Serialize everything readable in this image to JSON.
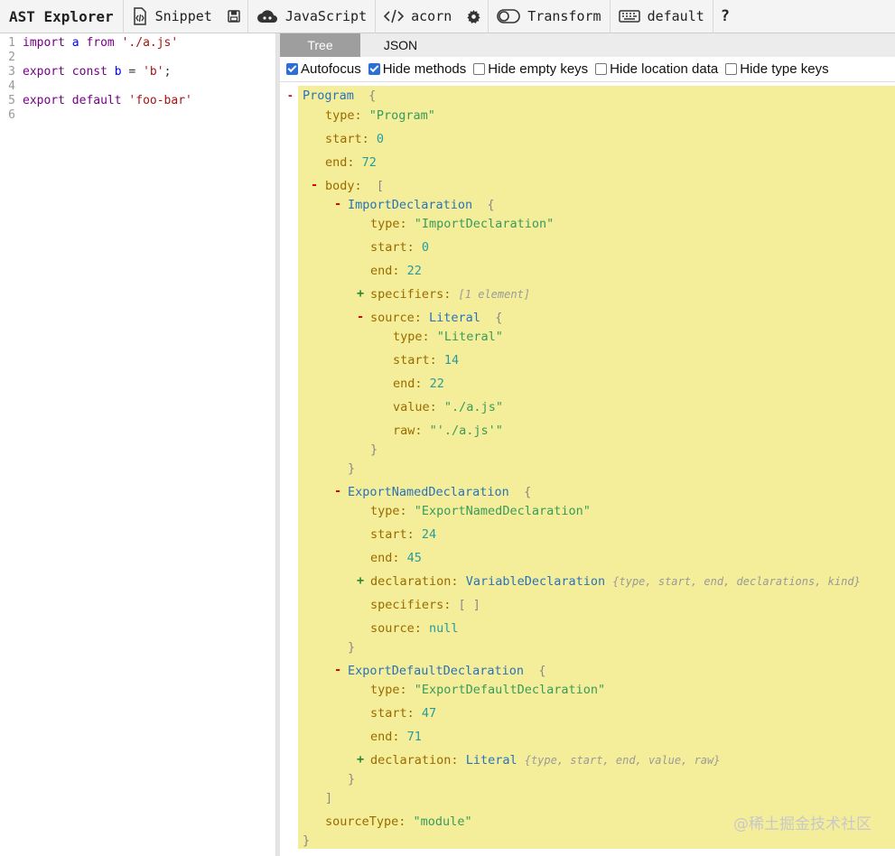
{
  "toolbar": {
    "title": "AST Explorer",
    "snippet": "Snippet",
    "language": "JavaScript",
    "parser": "acorn",
    "transform": "Transform",
    "keymap": "default",
    "help": "?"
  },
  "editor": {
    "lines": [
      {
        "n": "1",
        "text": "import a from './a.js'"
      },
      {
        "n": "2",
        "text": ""
      },
      {
        "n": "3",
        "text": "export const b = 'b';"
      },
      {
        "n": "4",
        "text": ""
      },
      {
        "n": "5",
        "text": "export default 'foo-bar'"
      },
      {
        "n": "6",
        "text": ""
      }
    ]
  },
  "output": {
    "tabs": [
      "Tree",
      "JSON"
    ],
    "active_tab": "Tree",
    "options": [
      {
        "label": "Autofocus",
        "checked": true
      },
      {
        "label": "Hide methods",
        "checked": true
      },
      {
        "label": "Hide empty keys",
        "checked": false
      },
      {
        "label": "Hide location data",
        "checked": false
      },
      {
        "label": "Hide type keys",
        "checked": false
      }
    ]
  },
  "tree": {
    "program": "Program",
    "brace_open": "{",
    "brace_close": "}",
    "bracket_open": "[",
    "bracket_close": "]",
    "empty_array": "[ ]",
    "type_key": "type:",
    "start_key": "start:",
    "end_key": "end:",
    "body_key": "body:",
    "specifiers_key": "specifiers:",
    "source_key": "source:",
    "value_key": "value:",
    "raw_key": "raw:",
    "declaration_key": "declaration:",
    "sourceType_key": "sourceType:",
    "program_type": "\"Program\"",
    "program_start": "0",
    "program_end": "72",
    "import_decl": "ImportDeclaration",
    "import_type": "\"ImportDeclaration\"",
    "import_start": "0",
    "import_end": "22",
    "import_specifiers_summary": "[1 element]",
    "literal": "Literal",
    "lit_type": "\"Literal\"",
    "lit_start": "14",
    "lit_end": "22",
    "lit_value": "\"./a.js\"",
    "lit_raw": "\"'./a.js'\"",
    "named_decl": "ExportNamedDeclaration",
    "named_type": "\"ExportNamedDeclaration\"",
    "named_start": "24",
    "named_end": "45",
    "var_decl": "VariableDeclaration",
    "var_decl_summary": "{type, start, end, declarations, kind}",
    "null": "null",
    "default_decl": "ExportDefaultDeclaration",
    "default_type": "\"ExportDefaultDeclaration\"",
    "default_start": "47",
    "default_end": "71",
    "default_literal_summary": "{type, start, end, value, raw}",
    "source_type": "\"module\"",
    "minus": "-",
    "plus": "+"
  },
  "watermark": "@稀土掘金技术社区"
}
